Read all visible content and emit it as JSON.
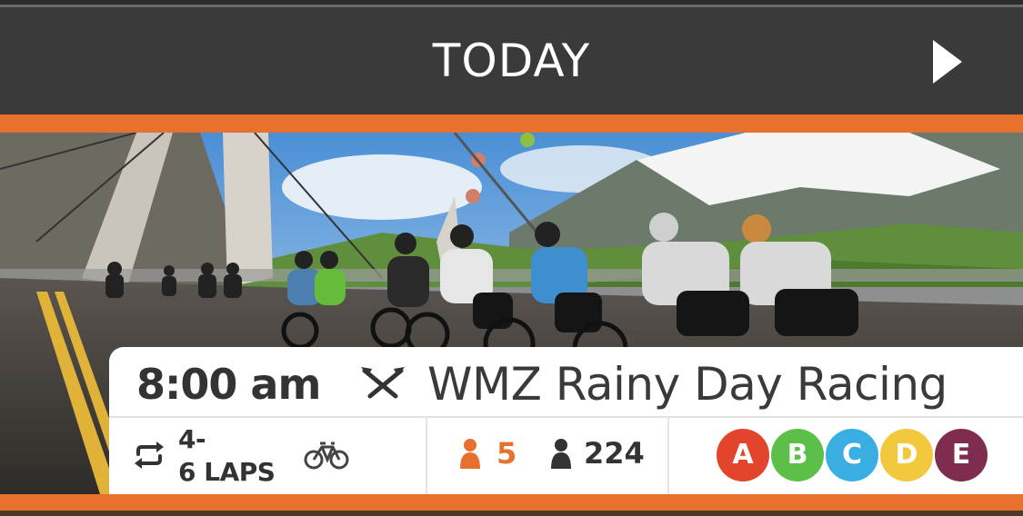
{
  "header": {
    "title": "TODAY",
    "next_icon": "play-right-icon"
  },
  "event": {
    "time": "8:00 am",
    "type_icon": "crossed-swords-race-icon",
    "name": "WMZ Rainy Day Racing",
    "laps_icon": "repeat-icon",
    "laps": "4-\n6 LAPS",
    "bike_icon": "bicycle-icon",
    "friends_count": "5",
    "friends_icon": "person-orange-icon",
    "total_count": "224",
    "total_icon": "person-icon",
    "categories": [
      {
        "label": "A",
        "color": "#e2452b"
      },
      {
        "label": "B",
        "color": "#5bbf4a"
      },
      {
        "label": "C",
        "color": "#3aaee3"
      },
      {
        "label": "D",
        "color": "#f2c93c"
      },
      {
        "label": "E",
        "color": "#7e2d4f"
      }
    ]
  },
  "colors": {
    "accent": "#e8702f",
    "header_bg": "#3a3a3a"
  }
}
